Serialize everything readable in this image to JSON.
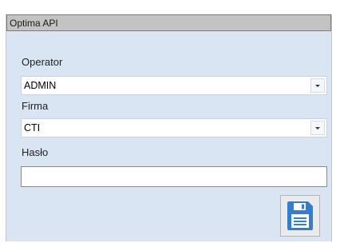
{
  "panel": {
    "title": "Optima API"
  },
  "form": {
    "operator": {
      "label": "Operator",
      "value": "ADMIN"
    },
    "firma": {
      "label": "Firma",
      "value": "CTI"
    },
    "haslo": {
      "label": "Hasło",
      "value": ""
    }
  },
  "actions": {
    "save_icon": "floppy-disk-icon"
  },
  "colors": {
    "panel_background": "#d9e5f3",
    "header_background": "#c3c3c3",
    "save_icon_blue": "#2f7fd8"
  }
}
